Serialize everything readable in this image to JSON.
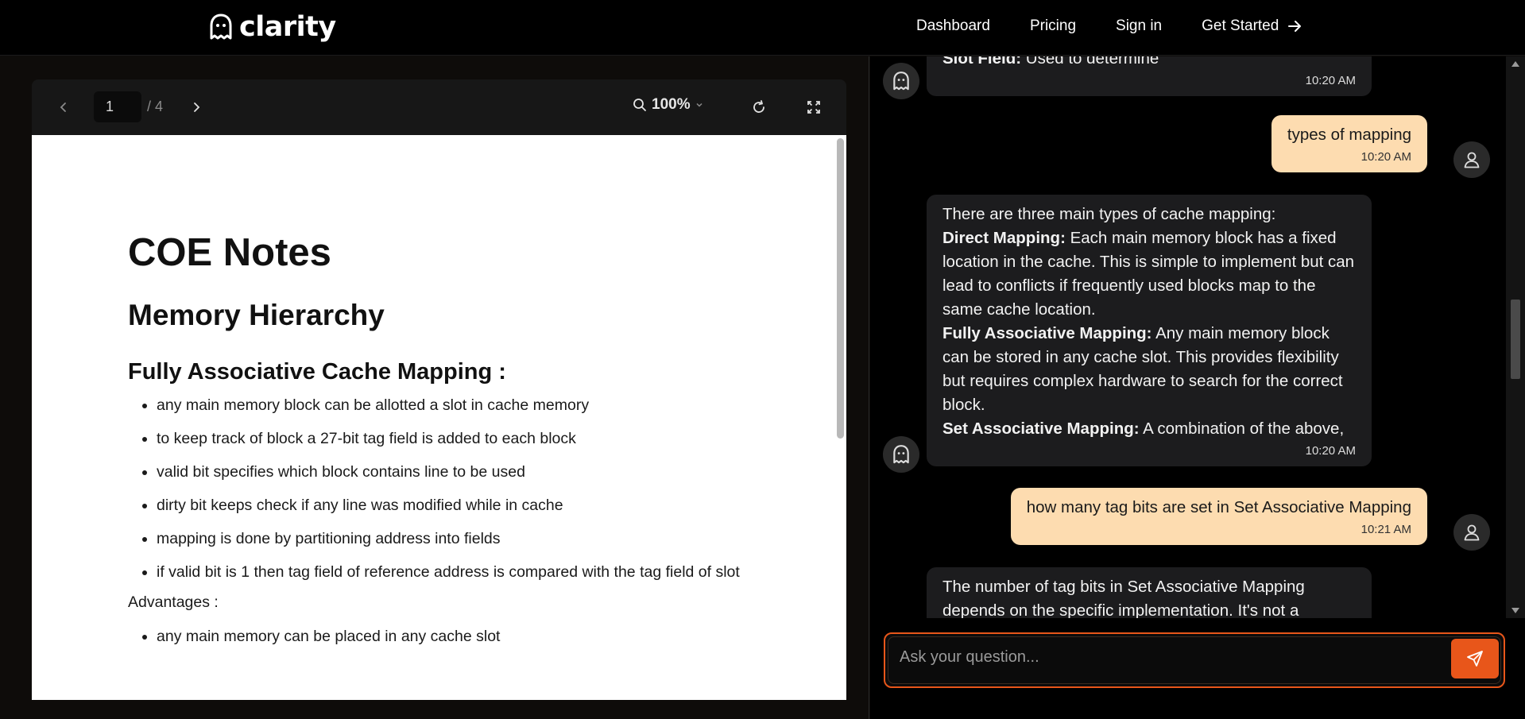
{
  "app": {
    "name": "clarity"
  },
  "nav": {
    "dashboard": "Dashboard",
    "pricing": "Pricing",
    "signin": "Sign in",
    "get_started": "Get Started"
  },
  "pdf_toolbar": {
    "page_current": "1",
    "page_total": "/ 4",
    "zoom": "100%"
  },
  "document": {
    "title": "COE Notes",
    "section": "Memory Hierarchy",
    "subsection": "Fully Associative Cache Mapping :",
    "bullets": [
      "any main memory block can be allotted a slot in cache memory",
      "to keep track of block a 27-bit tag field is added to each block",
      "valid bit specifies which block contains line to be used",
      "dirty bit keeps check if any line was modified while in cache",
      "mapping is done by partitioning address into fields",
      "if valid bit is 1 then tag field of reference address is compared with the tag field of slot"
    ],
    "advantages_label": "Advantages :",
    "advantages": [
      "any main memory can be placed in any cache slot"
    ]
  },
  "chat": {
    "messages": [
      {
        "role": "bot",
        "bold": "Slot Field:",
        "text": " Used to determine",
        "time": "10:20 AM"
      },
      {
        "role": "user",
        "text": "types of mapping",
        "time": "10:20 AM"
      },
      {
        "role": "bot",
        "intro": "There are three main types of cache mapping:",
        "items": [
          {
            "bold": "Direct Mapping:",
            "text": " Each main memory block has a fixed location in the cache. This is simple to implement but can lead to conflicts if frequently used blocks map to the same cache location."
          },
          {
            "bold": "Fully Associative Mapping:",
            "text": " Any main memory block can be stored in any cache slot. This provides flexibility but requires complex hardware to search for the correct block."
          },
          {
            "bold": "Set Associative Mapping:",
            "text": " A combination of the above,"
          }
        ],
        "time": "10:20 AM"
      },
      {
        "role": "user",
        "text": "how many tag bits are set in Set Associative Mapping",
        "time": "10:21 AM"
      },
      {
        "role": "bot",
        "text": "The number of tag bits in Set Associative Mapping depends on the specific implementation. It's not a"
      }
    ],
    "input_placeholder": "Ask your question..."
  },
  "colors": {
    "accent": "#e8561a",
    "user_bubble": "#fddcb0",
    "bot_bubble": "#1c1c1e"
  }
}
